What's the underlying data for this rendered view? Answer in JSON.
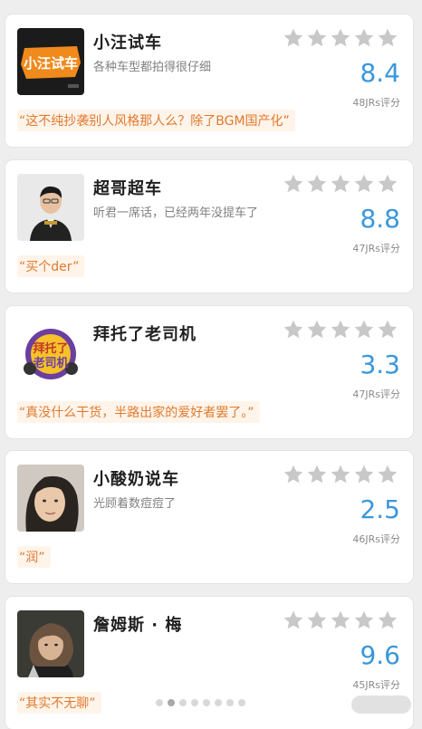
{
  "ratings": [
    {
      "name": "小汪试车",
      "desc": "各种车型都拍得很仔细",
      "score": "8.4",
      "count": "48JRs评分",
      "quote": "“这不纯抄袭别人风格那人么？除了BGM国产化”",
      "avatar": "logo-avatar"
    },
    {
      "name": "超哥超车",
      "desc": "听君一席话，已经两年没提车了",
      "score": "8.8",
      "count": "47JRs评分",
      "quote": "“买个der”",
      "avatar": "man-photo-avatar"
    },
    {
      "name": "拜托了老司机",
      "desc": "",
      "score": "3.3",
      "count": "47JRs评分",
      "quote": "“真没什么干货，半路出家的爱好者罢了。”",
      "avatar": "show-logo-avatar"
    },
    {
      "name": "小酸奶说车",
      "desc": "光顾着数痘痘了",
      "score": "2.5",
      "count": "46JRs评分",
      "quote": "“润”",
      "avatar": "woman-photo-avatar"
    },
    {
      "name": "詹姆斯 · 梅",
      "desc": "",
      "score": "9.6",
      "count": "45JRs评分",
      "quote": "“其实不无聊”",
      "avatar": "man-longhair-avatar"
    }
  ],
  "colors": {
    "score": "#3a97db",
    "quote": "#e07a2e",
    "star": "#c8c8c8"
  },
  "icons": {
    "star": "star-icon"
  }
}
